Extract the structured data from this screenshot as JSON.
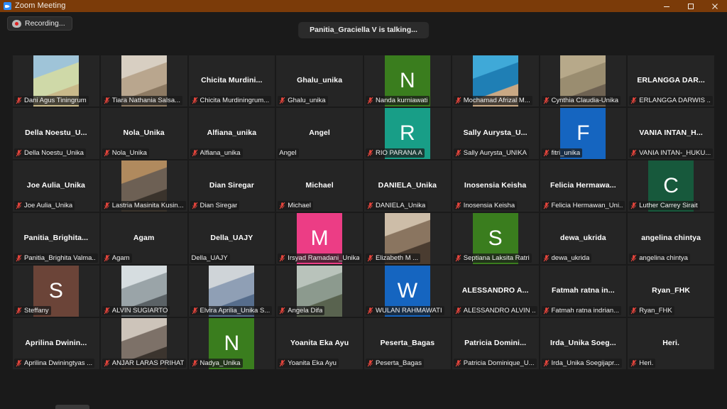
{
  "window": {
    "title": "Zoom Meeting",
    "app_icon": "zoom-video-icon",
    "controls": {
      "minimize": "minimize-icon",
      "maximize": "maximize-icon",
      "close": "close-icon"
    }
  },
  "overlay": {
    "recording_label": "Recording...",
    "recording_icon": "recording-cloud-icon",
    "talking_label": "Panitia_Graciella V is talking..."
  },
  "colors": {
    "titlebar": "#7b3b09",
    "background": "#1a1a1a",
    "tile": "#252525",
    "mic_muted": "#e8453c",
    "avatar_green": "#3a7d1e",
    "avatar_teal": "#189e87",
    "avatar_blue": "#1565c0",
    "avatar_darkgreen": "#17593c",
    "avatar_pink": "#ec3d85",
    "avatar_brown": "#6b4438"
  },
  "gallery": {
    "columns": 8,
    "rows": 6,
    "participants": [
      {
        "display_name": "",
        "footer_name": "Dani Agus Tiningrum",
        "muted": true,
        "media": "photo",
        "photo": "person-standing-hill"
      },
      {
        "display_name": "",
        "footer_name": "Tiara Nathania Salsa...",
        "muted": true,
        "media": "photo",
        "photo": "person-beige-coat-door"
      },
      {
        "display_name": "Chicita  Murdini...",
        "footer_name": "Chicita Murdiningrum...",
        "muted": true,
        "media": "none"
      },
      {
        "display_name": "Ghalu_unika",
        "footer_name": "Ghalu_unika",
        "muted": true,
        "media": "none"
      },
      {
        "display_name": "",
        "footer_name": "Nanda kurniawati",
        "muted": true,
        "media": "initial",
        "initial": "N",
        "avatar_color": "#3a7d1e"
      },
      {
        "display_name": "",
        "footer_name": "Mochamad Afrizal M...",
        "muted": true,
        "media": "photo",
        "photo": "person-beach-sea"
      },
      {
        "display_name": "",
        "footer_name": "Cynthia Claudia-Unika",
        "muted": true,
        "media": "photo",
        "photo": "totoro-cartoon-tan"
      },
      {
        "display_name": "ERLANGGA DAR...",
        "footer_name": "ERLANGGA DARWIS ...",
        "muted": true,
        "media": "none"
      },
      {
        "display_name": "Della  Noestu_U...",
        "footer_name": "Della Noestu_Unika",
        "muted": true,
        "media": "none"
      },
      {
        "display_name": "Nola_Unika",
        "footer_name": "Nola_Unika",
        "muted": true,
        "media": "none"
      },
      {
        "display_name": "Alfiana_unika",
        "footer_name": "Alfiana_unika",
        "muted": true,
        "media": "none"
      },
      {
        "display_name": "Angel",
        "footer_name": "Angel",
        "muted": false,
        "media": "none"
      },
      {
        "display_name": "",
        "footer_name": "RIO PARANA A",
        "muted": true,
        "media": "initial",
        "initial": "R",
        "avatar_color": "#189e87"
      },
      {
        "display_name": "Sally  Aurysta_U...",
        "footer_name": "Sally Aurysta_UNIKA",
        "muted": true,
        "media": "none"
      },
      {
        "display_name": "",
        "footer_name": "fitri_unika",
        "muted": true,
        "media": "initial",
        "initial": "F",
        "avatar_color": "#1565c0"
      },
      {
        "display_name": "VANIA INTAN_H...",
        "footer_name": "VANIA INTAN-_HUKU...",
        "muted": true,
        "media": "none"
      },
      {
        "display_name": "Joe Aulia_Unika",
        "footer_name": "Joe Aulia_Unika",
        "muted": true,
        "media": "none"
      },
      {
        "display_name": "",
        "footer_name": "Lastria Masinita Kusin...",
        "muted": true,
        "media": "photo",
        "photo": "woman-webcam-indoor"
      },
      {
        "display_name": "Dian Siregar",
        "footer_name": "Dian Siregar",
        "muted": true,
        "media": "none"
      },
      {
        "display_name": "Michael",
        "footer_name": "Michael",
        "muted": true,
        "media": "none"
      },
      {
        "display_name": "DANIELA_Unika",
        "footer_name": "DANIELA_Unika",
        "muted": true,
        "media": "none"
      },
      {
        "display_name": "Inosensia Keisha",
        "footer_name": "Inosensia Keisha",
        "muted": true,
        "media": "none"
      },
      {
        "display_name": "Felicia  Hermawa...",
        "footer_name": "Felicia Hermawan_Uni...",
        "muted": true,
        "media": "none"
      },
      {
        "display_name": "",
        "footer_name": "Luther Carrey Sirait",
        "muted": true,
        "media": "initial",
        "initial": "C",
        "avatar_color": "#17593c"
      },
      {
        "display_name": "Panitia_Brighita...",
        "footer_name": "Panitia_Brighita Valma...",
        "muted": true,
        "media": "none"
      },
      {
        "display_name": "Agam",
        "footer_name": "Agam",
        "muted": true,
        "media": "none"
      },
      {
        "display_name": "Della_UAJY",
        "footer_name": "Della_UAJY",
        "muted": false,
        "media": "none"
      },
      {
        "display_name": "",
        "footer_name": "Irsyad Ramadani_Unika",
        "muted": true,
        "media": "initial",
        "initial": "M",
        "avatar_color": "#ec3d85"
      },
      {
        "display_name": "",
        "footer_name": "Elizabeth M ...",
        "muted": true,
        "media": "photo",
        "photo": "woman-hands-face-indoor"
      },
      {
        "display_name": "",
        "footer_name": "Septiana Laksita Ratri",
        "muted": true,
        "media": "initial",
        "initial": "S",
        "avatar_color": "#3a7d1e"
      },
      {
        "display_name": "dewa_ukrida",
        "footer_name": "dewa_ukrida",
        "muted": true,
        "media": "none"
      },
      {
        "display_name": "angelina chintya",
        "footer_name": "angelina chintya",
        "muted": true,
        "media": "none"
      },
      {
        "display_name": "",
        "footer_name": "Steffany",
        "muted": true,
        "media": "initial",
        "initial": "S",
        "avatar_color": "#6b4438"
      },
      {
        "display_name": "",
        "footer_name": "ALVIN SUGIARTO",
        "muted": true,
        "media": "photo",
        "photo": "cyclist-outdoor"
      },
      {
        "display_name": "",
        "footer_name": "Elvira Aprilia_Unika S...",
        "muted": true,
        "media": "photo",
        "photo": "woman-denim-standing"
      },
      {
        "display_name": "",
        "footer_name": "Angela Difa",
        "muted": true,
        "media": "photo",
        "photo": "woman-mask-street"
      },
      {
        "display_name": "",
        "footer_name": "WULAN RAHMAWATI",
        "muted": true,
        "media": "initial",
        "initial": "W",
        "avatar_color": "#1565c0"
      },
      {
        "display_name": "ALESSANDRO A...",
        "footer_name": "ALESSANDRO ALVIN ...",
        "muted": true,
        "media": "none"
      },
      {
        "display_name": "Fatmah ratna in...",
        "footer_name": "Fatmah ratna indrian...",
        "muted": true,
        "media": "none"
      },
      {
        "display_name": "Ryan_FHK",
        "footer_name": "Ryan_FHK",
        "muted": true,
        "media": "none"
      },
      {
        "display_name": "Aprilina  Dwinin...",
        "footer_name": "Aprilina Dwiningtyas ...",
        "muted": true,
        "media": "none"
      },
      {
        "display_name": "",
        "footer_name": "ANJAR LARAS PRIHAT...",
        "muted": true,
        "media": "photo",
        "photo": "woman-mirror-selfie"
      },
      {
        "display_name": "",
        "footer_name": "Nadya_Unika",
        "muted": true,
        "media": "initial",
        "initial": "N",
        "avatar_color": "#3a7d1e"
      },
      {
        "display_name": "Yoanita Eka Ayu",
        "footer_name": "Yoanita Eka Ayu",
        "muted": true,
        "media": "none"
      },
      {
        "display_name": "Peserta_Bagas",
        "footer_name": "Peserta_Bagas",
        "muted": true,
        "media": "none"
      },
      {
        "display_name": "Patricia  Domini...",
        "footer_name": "Patricia Dominique_U...",
        "muted": true,
        "media": "none"
      },
      {
        "display_name": "Irda_Unika  Soeg...",
        "footer_name": "Irda_Unika Soegijapr...",
        "muted": true,
        "media": "none"
      },
      {
        "display_name": "Heri.",
        "footer_name": "Heri.",
        "muted": true,
        "media": "none"
      }
    ]
  }
}
